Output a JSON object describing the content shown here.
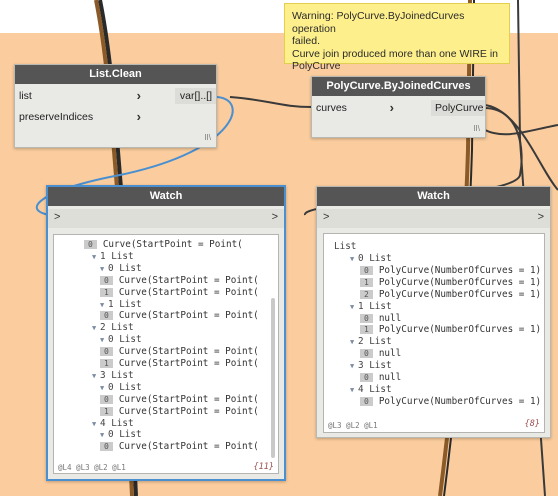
{
  "warning": {
    "text": "Warning: PolyCurve.ByJoinedCurves operation\nfailed.\nCurve join produced more than one WIRE in\nPolyCurve"
  },
  "list_clean": {
    "title": "List.Clean",
    "inputs": [
      "list",
      "preserveIndices"
    ],
    "output": "var[]..[]",
    "lacing": "l l \\"
  },
  "polycurve": {
    "title": "PolyCurve.ByJoinedCurves",
    "input": "curves",
    "output": "PolyCurve",
    "lacing": "l l \\"
  },
  "watch1": {
    "title": "Watch",
    "in_chevron": ">",
    "out_chevron": ">",
    "rows": [
      {
        "ind": "",
        "idx": "0",
        "text": "Curve(StartPoint = Point("
      },
      {
        "ind": "1",
        "hdr": "1 List"
      },
      {
        "ind": "2",
        "hdr": "0 List"
      },
      {
        "ind": "2",
        "idx": "0",
        "text": "Curve(StartPoint = Point("
      },
      {
        "ind": "2",
        "idx": "1",
        "text": "Curve(StartPoint = Point("
      },
      {
        "ind": "2",
        "hdr": "1 List"
      },
      {
        "ind": "2",
        "idx": "0",
        "text": "Curve(StartPoint = Point("
      },
      {
        "ind": "1",
        "hdr": "2 List"
      },
      {
        "ind": "2",
        "hdr": "0 List"
      },
      {
        "ind": "2",
        "idx": "0",
        "text": "Curve(StartPoint = Point("
      },
      {
        "ind": "2",
        "idx": "1",
        "text": "Curve(StartPoint = Point("
      },
      {
        "ind": "1",
        "hdr": "3 List"
      },
      {
        "ind": "2",
        "hdr": "0 List"
      },
      {
        "ind": "2",
        "idx": "0",
        "text": "Curve(StartPoint = Point("
      },
      {
        "ind": "2",
        "idx": "1",
        "text": "Curve(StartPoint = Point("
      },
      {
        "ind": "1",
        "hdr": "4 List"
      },
      {
        "ind": "2",
        "hdr": "0 List"
      },
      {
        "ind": "2",
        "idx": "0",
        "text": "Curve(StartPoint = Point("
      }
    ],
    "levels": "@L4 @L3 @L2 @L1",
    "count": "{11}"
  },
  "watch2": {
    "title": "Watch",
    "in_chevron": ">",
    "out_chevron": ">",
    "root": "List",
    "rows": [
      {
        "ind": "1",
        "hdr": "0 List"
      },
      {
        "ind": "2",
        "idx": "0",
        "text": "PolyCurve(NumberOfCurves = 1)"
      },
      {
        "ind": "2",
        "idx": "1",
        "text": "PolyCurve(NumberOfCurves = 1)"
      },
      {
        "ind": "2",
        "idx": "2",
        "text": "PolyCurve(NumberOfCurves = 1)"
      },
      {
        "ind": "1",
        "hdr": "1 List"
      },
      {
        "ind": "2",
        "idx": "0",
        "text": "null"
      },
      {
        "ind": "2",
        "idx": "1",
        "text": "PolyCurve(NumberOfCurves = 1)"
      },
      {
        "ind": "1",
        "hdr": "2 List"
      },
      {
        "ind": "2",
        "idx": "0",
        "text": "null"
      },
      {
        "ind": "1",
        "hdr": "3 List"
      },
      {
        "ind": "2",
        "idx": "0",
        "text": "null"
      },
      {
        "ind": "1",
        "hdr": "4 List"
      },
      {
        "ind": "2",
        "idx": "0",
        "text": "PolyCurve(NumberOfCurves = 1)"
      }
    ],
    "levels": "@L3 @L2 @L1",
    "count": "{8}"
  },
  "colors": {
    "canvas": "#fbcd9e",
    "node_header": "#555555",
    "selected_border": "#4a8fd0",
    "warning_bg": "#fdef8c",
    "wire_brown": "#7a4a1c",
    "wire_dark": "#3a3a3a",
    "wire_blue": "#4a8fd0"
  }
}
